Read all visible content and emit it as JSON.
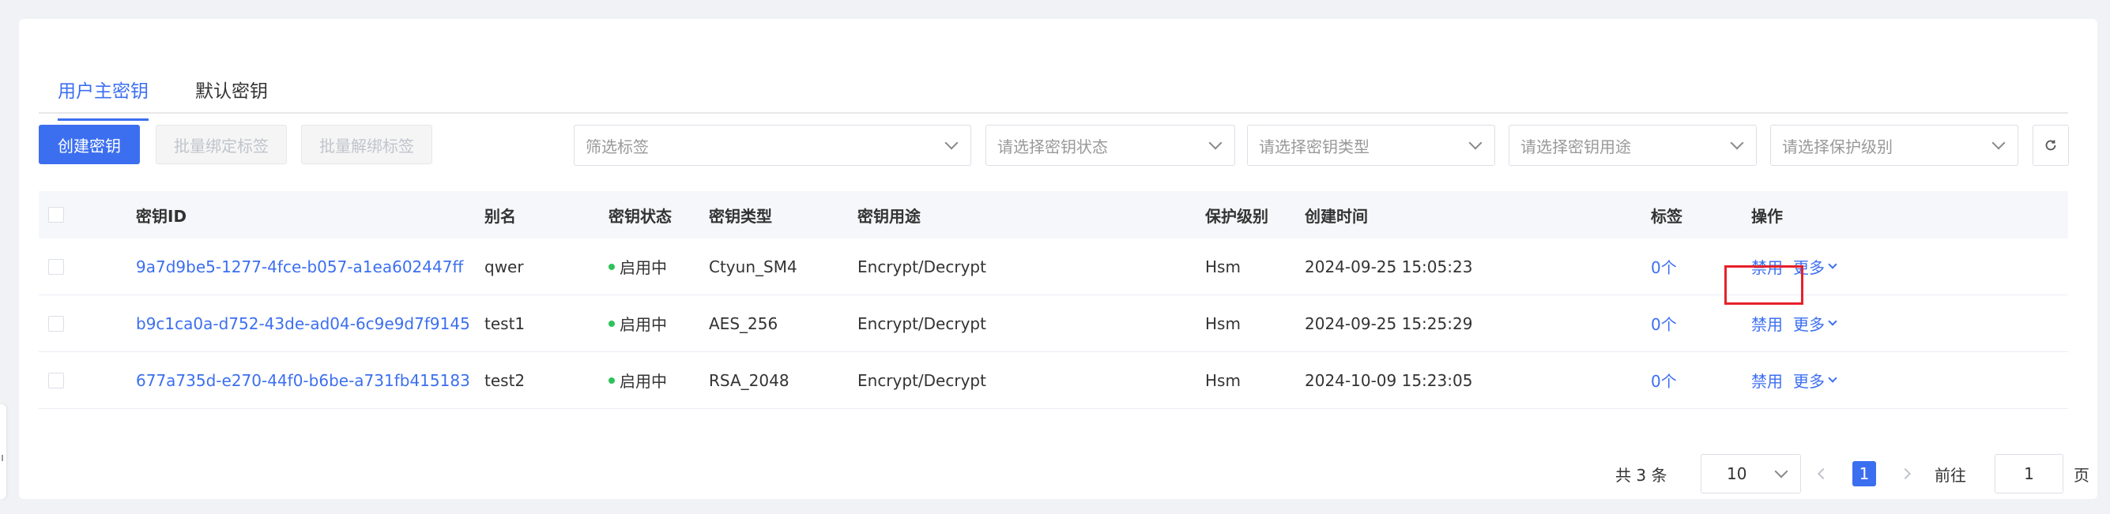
{
  "tabs": [
    {
      "label": "用户主密钥",
      "active": true
    },
    {
      "label": "默认密钥",
      "active": false
    }
  ],
  "toolbar": {
    "create_label": "创建密钥",
    "bind_tags_label": "批量绑定标签",
    "unbind_tags_label": "批量解绑标签"
  },
  "filters": {
    "tags_placeholder": "筛选标签",
    "status_placeholder": "请选择密钥状态",
    "type_placeholder": "请选择密钥类型",
    "usage_placeholder": "请选择密钥用途",
    "protection_placeholder": "请选择保护级别"
  },
  "table": {
    "headers": {
      "key_id": "密钥ID",
      "alias": "别名",
      "status": "密钥状态",
      "type": "密钥类型",
      "usage": "密钥用途",
      "protection": "保护级别",
      "created": "创建时间",
      "tags": "标签",
      "actions": "操作"
    },
    "rows": [
      {
        "key_id": "9a7d9be5-1277-4fce-b057-a1ea602447ff",
        "alias": "qwer",
        "status": "启用中",
        "type": "Ctyun_SM4",
        "usage": "Encrypt/Decrypt",
        "protection": "Hsm",
        "created": "2024-09-25 15:05:23",
        "tags": "0个",
        "disable": "禁用",
        "more": "更多"
      },
      {
        "key_id": "b9c1ca0a-d752-43de-ad04-6c9e9d7f9145",
        "alias": "test1",
        "status": "启用中",
        "type": "AES_256",
        "usage": "Encrypt/Decrypt",
        "protection": "Hsm",
        "created": "2024-09-25 15:25:29",
        "tags": "0个",
        "disable": "禁用",
        "more": "更多"
      },
      {
        "key_id": "677a735d-e270-44f0-b6be-a731fb415183",
        "alias": "test2",
        "status": "启用中",
        "type": "RSA_2048",
        "usage": "Encrypt/Decrypt",
        "protection": "Hsm",
        "created": "2024-10-09 15:23:05",
        "tags": "0个",
        "disable": "禁用",
        "more": "更多"
      }
    ]
  },
  "pagination": {
    "total_label": "共 3 条",
    "page_size": "10",
    "current_page": "1",
    "goto_label": "前往",
    "goto_value": "1",
    "page_unit": "页"
  },
  "colors": {
    "accent": "#3c6ff0",
    "status_active": "#2fc25b",
    "highlight": "#e6212a"
  }
}
